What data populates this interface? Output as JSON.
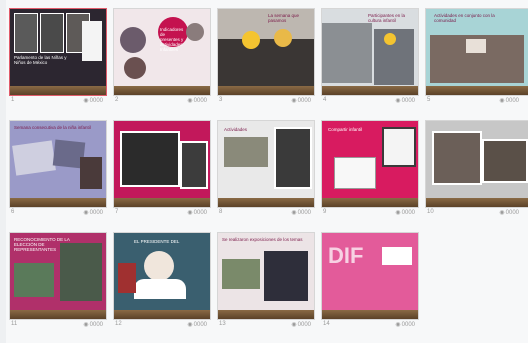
{
  "slides": [
    {
      "number": "1",
      "views": "0000",
      "title": "Parlamento de las Niñas y Niños de México"
    },
    {
      "number": "2",
      "views": "0000",
      "title": "Indicadores de presentes y actividades Infantiles"
    },
    {
      "number": "3",
      "views": "0000",
      "title": "La semana que pasamos"
    },
    {
      "number": "4",
      "views": "0000",
      "title": "Participantes en la cultura infantil"
    },
    {
      "number": "5",
      "views": "0000",
      "title": "Actividades en conjunto con la comunidad"
    },
    {
      "number": "6",
      "views": "0000",
      "title": "Semana consecutiva de la niña infantil"
    },
    {
      "number": "7",
      "views": "0000",
      "title": ""
    },
    {
      "number": "8",
      "views": "0000",
      "title": "Actividades"
    },
    {
      "number": "9",
      "views": "0000",
      "title": "Compartir infantil"
    },
    {
      "number": "10",
      "views": "0000",
      "title": ""
    },
    {
      "number": "11",
      "views": "0000",
      "title": "RECONOCIMIENTO DE LA ELECCIÓN DE REPRESENTANTES"
    },
    {
      "number": "12",
      "views": "0000",
      "title": "EL PRESIDENTE DEL"
    },
    {
      "number": "13",
      "views": "0000",
      "title": "Se realizaron exposiciones de los temas"
    },
    {
      "number": "14",
      "views": "0000",
      "title": "DIF"
    }
  ]
}
